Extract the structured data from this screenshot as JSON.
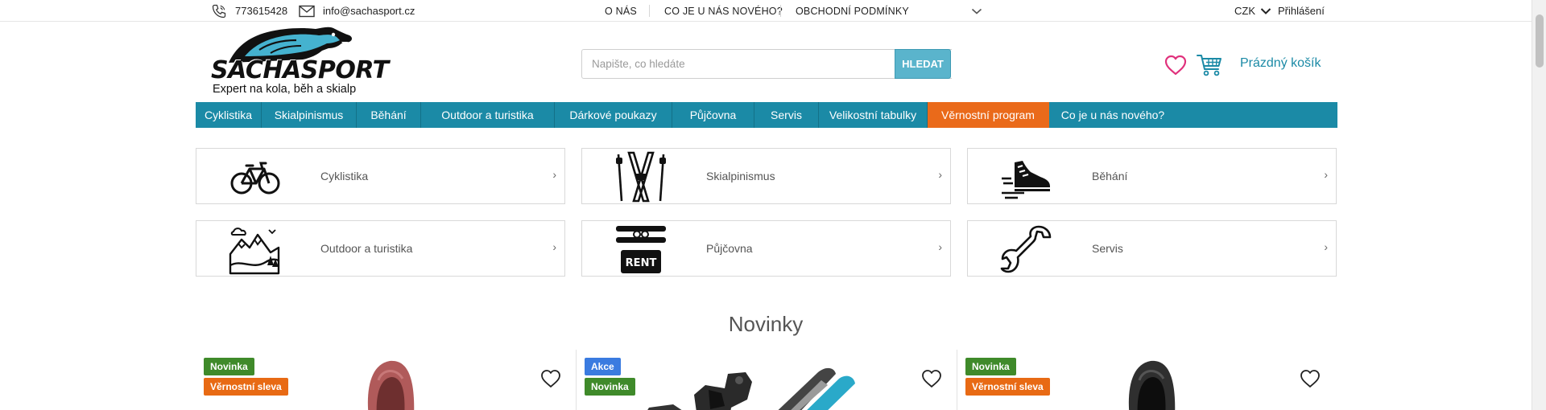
{
  "topbar": {
    "phone": "773615428",
    "email": "info@sachasport.cz",
    "nav": [
      "O NÁS",
      "CO JE U NÁS NOVÉHO?",
      "OBCHODNÍ PODMÍNKY"
    ],
    "currency": "CZK",
    "login": "Přihlášení"
  },
  "brand": {
    "name": "SACHASPORT",
    "tagline": "Expert na kola, běh a skialp"
  },
  "search": {
    "placeholder": "Napište, co hledáte",
    "value": "",
    "button": "HLEDAT"
  },
  "cart": {
    "label": "Prázdný košík"
  },
  "nav": [
    {
      "label": "Cyklistika"
    },
    {
      "label": "Skialpinismus"
    },
    {
      "label": "Běhání"
    },
    {
      "label": "Outdoor a turistika"
    },
    {
      "label": "Dárkové poukazy"
    },
    {
      "label": "Půjčovna"
    },
    {
      "label": "Servis"
    },
    {
      "label": "Velikostní tabulky"
    },
    {
      "label": "Věrnostní program",
      "highlight": true
    },
    {
      "label": "Co je u nás nového?"
    }
  ],
  "categories": [
    {
      "label": "Cyklistika",
      "icon": "bicycle-icon"
    },
    {
      "label": "Skialpinismus",
      "icon": "skis-icon"
    },
    {
      "label": "Běhání",
      "icon": "running-shoe-icon"
    },
    {
      "label": "Outdoor a turistika",
      "icon": "mountains-icon"
    },
    {
      "label": "Půjčovna",
      "icon": "rent-icon"
    },
    {
      "label": "Servis",
      "icon": "wrench-icon"
    }
  ],
  "news": {
    "title": "Novinky",
    "products": [
      {
        "badges": [
          "Novinka",
          "Věrnostní sleva"
        ]
      },
      {
        "badges": [
          "Akce",
          "Novinka"
        ]
      },
      {
        "badges": [
          "Novinka",
          "Věrnostní sleva"
        ]
      }
    ]
  },
  "colors": {
    "accent": "#1b8aa6",
    "highlight": "#ea6a1a",
    "badge_green": "#3f8a2a",
    "badge_blue": "#3a7be0",
    "wishlist": "#e0317c"
  }
}
